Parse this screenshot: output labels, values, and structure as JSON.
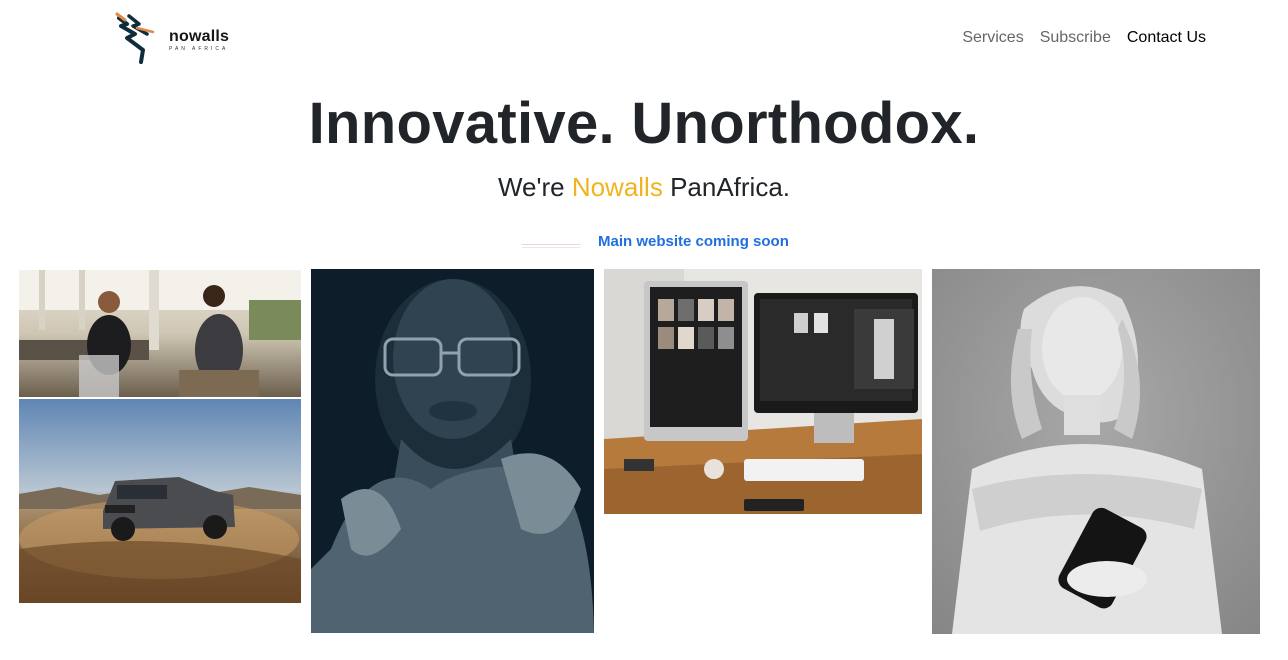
{
  "header": {
    "logo": {
      "word": "nowalls",
      "sub": "Pan Africa"
    },
    "nav": [
      {
        "label": "Services"
      },
      {
        "label": "Subscribe"
      },
      {
        "label": "Contact Us"
      }
    ]
  },
  "hero": {
    "title": "Innovative. Unorthodox.",
    "subtitle_pre": "We're ",
    "subtitle_brand": "Nowalls",
    "subtitle_post": " PanAfrica.",
    "coming_soon": "Main website coming soon"
  },
  "colors": {
    "brand_yellow": "#f2b31c",
    "link_blue": "#1f6fe0",
    "heading": "#212529"
  },
  "gallery": [
    {
      "name": "office-meeting-photo"
    },
    {
      "name": "suv-desert-photo"
    },
    {
      "name": "woman-portrait-photo"
    },
    {
      "name": "desk-monitors-photo"
    },
    {
      "name": "statue-phone-photo"
    }
  ]
}
